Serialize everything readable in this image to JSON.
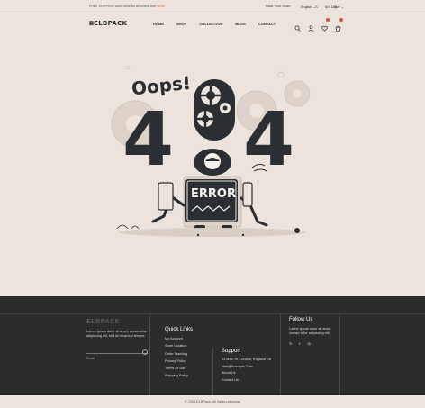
{
  "topbar": {
    "promo_text": "FREE SHIPPING world wide for all orders over ",
    "promo_amount": "$199",
    "track_order": "Track Your Order",
    "language": "English ⌄",
    "currency": "US Dollar ⌄",
    "socials": [
      "𝕏",
      "f",
      "◎"
    ]
  },
  "header": {
    "logo_pre": "🞖",
    "logo": "ELBPACK",
    "nav": [
      "HOME",
      "SHOP",
      "COLLECTION",
      "BLOG",
      "CONTACT"
    ],
    "icons": [
      "search-icon",
      "user-icon",
      "heart-icon",
      "cart-icon"
    ]
  },
  "hero": {
    "oops": "Oops!",
    "code_left": "4",
    "code_right": "4",
    "screen_text": "ERROR"
  },
  "footer": {
    "logo": "ELBPACK",
    "description": "Lorem ipsum dolor sit amet, consectetur adipiscing elit, sed do eiusmod tempor.",
    "email_label": "Email",
    "email_arrow": "→",
    "quick_links_title": "Quick Links",
    "quick_links": [
      "My Account",
      "Store Location",
      "Order Tracking",
      "Privacy Policy",
      "Terms Of Use",
      "Shipping Policy"
    ],
    "support_title": "Support",
    "support_address": "13 Main St, London, England UK",
    "support_email": "Mail@Example.Com",
    "support_links": [
      "About Us",
      "Contact Us"
    ],
    "follow_title": "Follow Us",
    "follow_desc": "Lorem ipsum dolor sit amet, consec tetur adipiscing elit.",
    "socials": [
      "𝕏",
      "f",
      "◎"
    ],
    "copyright": "© 2024 ELBPack. All rights reserved."
  },
  "colors": {
    "background": "#ece4dc",
    "footer": "#2c2c2c",
    "accent": "#e0532f",
    "ink": "#2b2b2b"
  }
}
